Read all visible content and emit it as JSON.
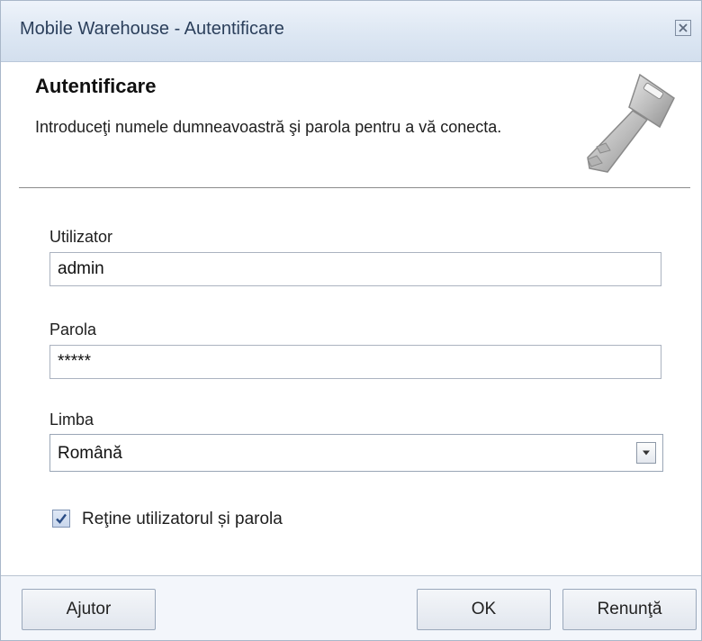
{
  "window": {
    "title": "Mobile Warehouse - Autentificare"
  },
  "header": {
    "title": "Autentificare",
    "description": "Introduceţi numele dumneavoastră şi parola pentru a vă conecta.",
    "icon": "key-icon"
  },
  "form": {
    "username": {
      "label": "Utilizator",
      "value": "admin"
    },
    "password": {
      "label": "Parola",
      "value": "*****"
    },
    "language": {
      "label": "Limba",
      "value": "Română"
    },
    "remember": {
      "label": "Reţine utilizatorul și parola",
      "checked": true
    }
  },
  "buttons": {
    "help": "Ajutor",
    "ok": "OK",
    "cancel": "Renunţă"
  },
  "colors": {
    "titlebar": "#dde7f3",
    "title_text": "#2b3f5b",
    "footer": "#f3f6fb"
  }
}
